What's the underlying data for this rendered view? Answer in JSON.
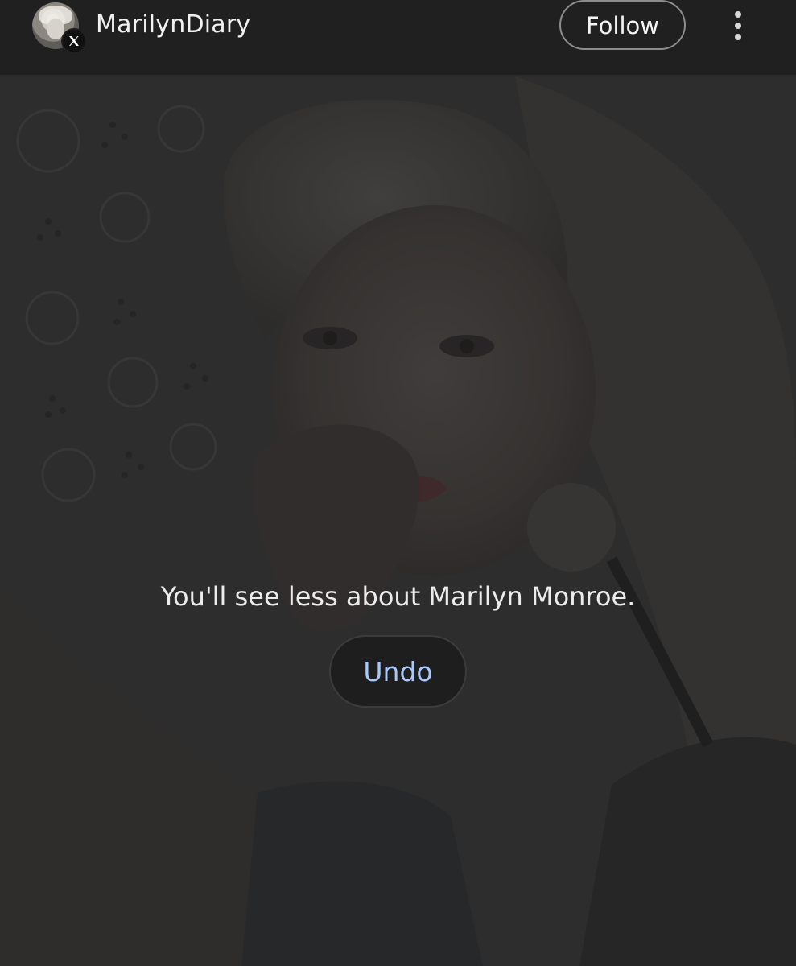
{
  "header": {
    "username": "MarilynDiary",
    "follow_label": "Follow"
  },
  "overlay": {
    "message": "You'll see less about Marilyn Monroe.",
    "undo_label": "Undo"
  },
  "colors": {
    "header_bg": "#202020",
    "undo_text": "#a8c7fa",
    "message_text": "#ececec"
  },
  "icons": [
    "x-logo-icon",
    "more-vert-icon"
  ]
}
